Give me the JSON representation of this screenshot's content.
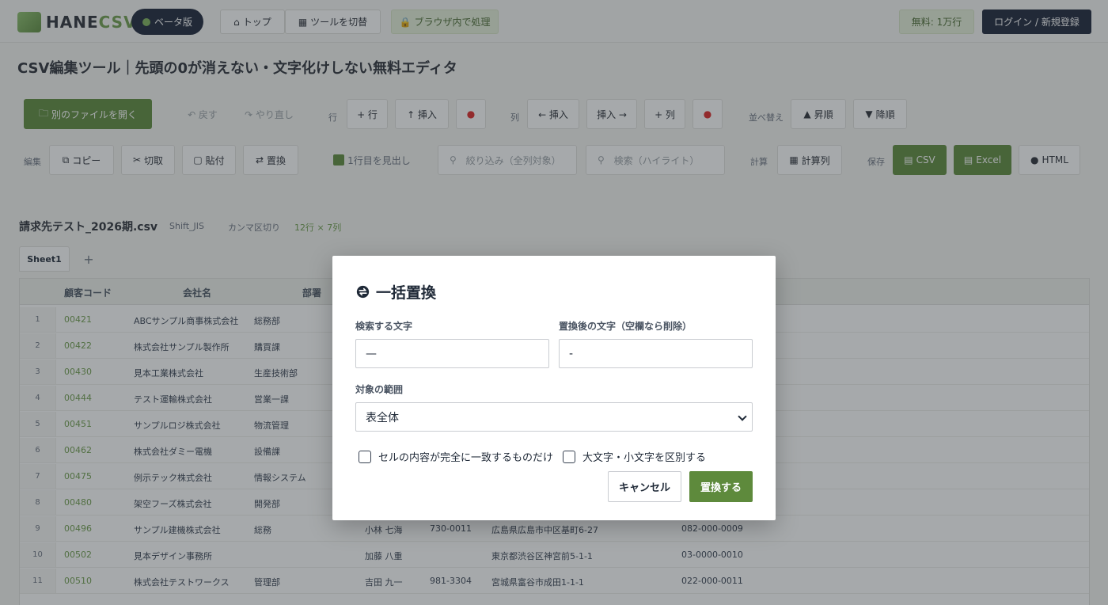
{
  "header": {
    "logo_text_hane": "HANE",
    "logo_text_csv": "CSV",
    "beta_label": "ベータ版",
    "top_label": "トップ",
    "tool_switch_label": "ツールを切替",
    "browser_only_label": "ブラウザ内で処理",
    "free_plan_label": "無料: 1万行",
    "login_label": "ログイン / 新規登録"
  },
  "page": {
    "title": "CSV編集ツール｜先頭の0が消えない・文字化けしない無料エディタ"
  },
  "toolbar": {
    "open_file_label": "別のファイルを開く",
    "undo_label": "↶ 戻す",
    "redo_label": "↷ やり直し",
    "row_label": "行",
    "add_row_label": "+ 行",
    "insert_row_label": "↑ 挿入",
    "col_label": "列",
    "insert_col_left_label": "← 挿入",
    "insert_col_right_label": "挿入 →",
    "add_col_label": "+ 列",
    "sort_label": "並べ替え",
    "sort_asc_label": "昇順",
    "sort_desc_label": "降順",
    "edit_label": "編集",
    "copy_label": "コピー",
    "cut_label": "切取",
    "paste_label": "貼付",
    "replace_label": "置換",
    "header_row_label": "1行目を見出し",
    "filter_placeholder": "絞り込み（全列対象）",
    "search_placeholder": "検索（ハイライト）",
    "calc_label": "計算",
    "calc_col_label": "計算列",
    "save_label": "保存",
    "csv_label": "CSV",
    "excel_label": "Excel",
    "html_label": "HTML"
  },
  "file": {
    "name": "請求先テスト_2026期.csv",
    "encoding": "Shift_JIS",
    "delimiter": "カンマ区切り",
    "size": "12行 × 7列"
  },
  "sheet": {
    "tab_label": "Sheet1",
    "add_label": "+"
  },
  "grid": {
    "headers": [
      "顧客コード",
      "会社名",
      "部署"
    ],
    "rows": [
      {
        "n": "1",
        "code": "00421",
        "company": "ABCサンプル商事株式会社",
        "dept": "総務部"
      },
      {
        "n": "2",
        "code": "00422",
        "company": "株式会社サンプル製作所",
        "dept": "購買課"
      },
      {
        "n": "3",
        "code": "00430",
        "company": "見本工業株式会社",
        "dept": "生産技術部"
      },
      {
        "n": "4",
        "code": "00444",
        "company": "テスト運輸株式会社",
        "dept": "営業一課"
      },
      {
        "n": "5",
        "code": "00451",
        "company": "サンプルロジ株式会社",
        "dept": "物流管理"
      },
      {
        "n": "6",
        "code": "00462",
        "company": "株式会社ダミー電機",
        "dept": "設備課"
      },
      {
        "n": "7",
        "code": "00475",
        "company": "例示テック株式会社",
        "dept": "情報システム"
      },
      {
        "n": "8",
        "code": "00480",
        "company": "架空フーズ株式会社",
        "dept": "開発部"
      },
      {
        "n": "9",
        "code": "00496",
        "company": "サンプル建機株式会社",
        "dept": "総務",
        "person": "小林 七海",
        "zip": "730-0011",
        "addr": "広島県広島市中区基町6-27",
        "tel": "082-000-0009"
      },
      {
        "n": "10",
        "code": "00502",
        "company": "見本デザイン事務所",
        "dept": "",
        "person": "加藤 八重",
        "zip": "",
        "addr": "東京都渋谷区神宮前5-1-1",
        "tel": "03-0000-0010"
      },
      {
        "n": "11",
        "code": "00510",
        "company": "株式会社テストワークス",
        "dept": "管理部",
        "person": "吉田 九一",
        "zip": "981-3304",
        "addr": "宮城県富谷市成田1-1-1",
        "tel": "022-000-0011"
      }
    ]
  },
  "modal": {
    "title": "一括置換",
    "search_label": "検索する文字",
    "search_value": "—",
    "replace_label": "置換後の文字（空欄なら削除）",
    "replace_value": "-",
    "scope_label": "対象の範囲",
    "scope_value": "表全体",
    "exact_match_label": "セルの内容が完全に一致するものだけ",
    "case_sensitive_label": "大文字・小文字を区別する",
    "cancel_label": "キャンセル",
    "submit_label": "置換する"
  },
  "colors": {
    "accent": "#5e8a3c",
    "dark": "#1b2338"
  }
}
